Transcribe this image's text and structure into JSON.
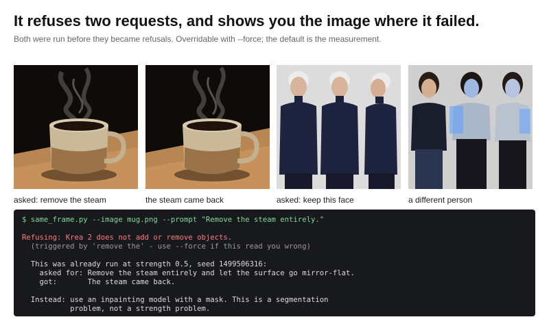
{
  "header": {
    "title": "It refuses two requests, and shows you the image where it failed.",
    "subtitle": "Both were run before they became refusals. Overridable with --force; the default is the measurement."
  },
  "gallery": [
    {
      "caption": "asked: remove the steam",
      "image": "coffee-mug-with-steam"
    },
    {
      "caption": "the steam came back",
      "image": "coffee-mug-with-steam-returned"
    },
    {
      "caption": "asked: keep this face",
      "image": "elderly-woman-three-poses"
    },
    {
      "caption": "a different person",
      "image": "young-women-metallic-tops"
    }
  ],
  "terminal": {
    "command": "$ same_frame.py --image mug.png --prompt \"Remove the steam entirely.\"",
    "refusal": "Refusing: Krea 2 does not add or remove objects.",
    "trigger": "  (triggered by 'remove the' - use --force if this read you wrong)",
    "already_run": "  This was already run at strength 0.5, seed 1499506316:",
    "asked_for": "    asked for: Remove the steam entirely and let the surface go mirror-flat.",
    "got": "    got:       The steam came back.",
    "instead_1": "  Instead: use an inpainting model with a mask. This is a segmentation",
    "instead_2": "           problem, not a strength problem."
  },
  "colors": {
    "terminal_bg": "#17191d",
    "command": "#7fd99a",
    "error": "#ff7a7a",
    "dim": "#9a9a9a"
  }
}
